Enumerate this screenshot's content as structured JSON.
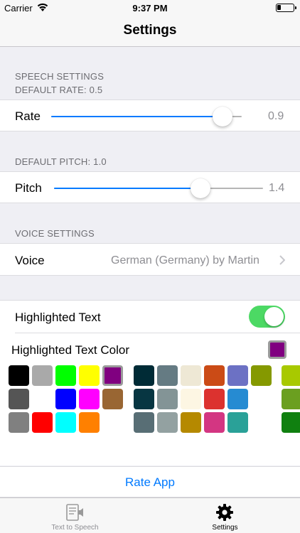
{
  "status_bar": {
    "carrier": "Carrier",
    "time": "9:37 PM"
  },
  "nav": {
    "title": "Settings"
  },
  "speech_section": {
    "header": "SPEECH SETTINGS",
    "default_rate": "DEFAULT RATE: 0.5"
  },
  "rate": {
    "label": "Rate",
    "value_text": "0.9",
    "fraction": 0.9
  },
  "pitch_section": {
    "default_pitch": "DEFAULT PITCH: 1.0"
  },
  "pitch": {
    "label": "Pitch",
    "value_text": "1.4",
    "fraction": 0.7
  },
  "voice_section": {
    "header": "VOICE SETTINGS"
  },
  "voice": {
    "label": "Voice",
    "value": "German (Germany) by Martin"
  },
  "highlight": {
    "label": "Highlighted Text",
    "enabled": true,
    "color_label": "Highlighted Text Color",
    "selected_color": "#800080"
  },
  "palette": {
    "groups": [
      [
        "#000000",
        "#a9a9a9",
        "#00ff00",
        "#ffff00",
        "#800080",
        "#555555",
        null,
        "#0000ff",
        "#ff00ff",
        "#996633",
        "#808080",
        "#ff0000",
        "#00ffff",
        "#ff8000",
        null
      ],
      [
        "#002b36",
        "#657b83",
        "#eee8d5",
        "#cb4b16",
        "#6c71c4",
        "#859900",
        "#073642",
        "#839496",
        "#fdf6e3",
        "#dc322f",
        "#268bd2",
        null,
        "#586e75",
        "#93a1a1",
        "#b58900",
        "#d33682",
        "#2aa198",
        null
      ],
      [
        "#a8c900",
        "#6b9f20",
        "#108010"
      ]
    ],
    "selected": "#800080"
  },
  "rate_app": {
    "label": "Rate App"
  },
  "tabs": [
    {
      "label": "Text to Speech",
      "active": false
    },
    {
      "label": "Settings",
      "active": true
    }
  ],
  "colors": {
    "accent": "#007aff",
    "toggle_on": "#4cd964",
    "tab_inactive": "#8e8e93"
  }
}
